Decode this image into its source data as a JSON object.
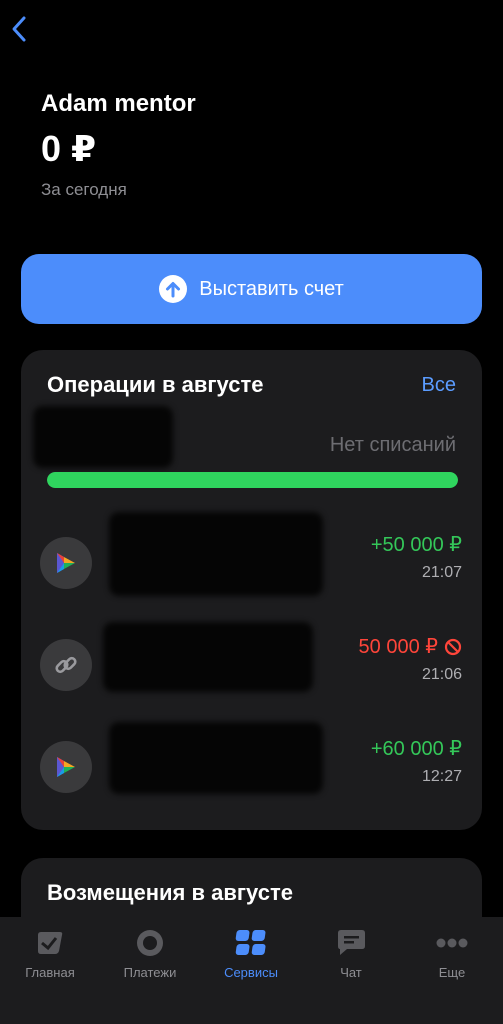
{
  "header": {
    "title": "Adam mentor",
    "amount": "0 ₽",
    "subtitle": "За сегодня"
  },
  "invoice_button": {
    "label": "Выставить счет"
  },
  "operations": {
    "title": "Операции в августе",
    "all_label": "Все",
    "no_charges": "Нет списаний",
    "progress_fraction": 1.0,
    "items": [
      {
        "amount": "+50 000 ₽",
        "time": "21:07",
        "type": "income",
        "icon": "sbp-icon"
      },
      {
        "amount": "50 000 ₽",
        "time": "21:06",
        "type": "declined",
        "icon": "link-icon"
      },
      {
        "amount": "+60 000 ₽",
        "time": "12:27",
        "type": "income",
        "icon": "sbp-icon"
      }
    ]
  },
  "compensations": {
    "title": "Возмещения в августе"
  },
  "tabbar": {
    "tabs": [
      {
        "label": "Главная",
        "icon": "home-icon",
        "active": false
      },
      {
        "label": "Платежи",
        "icon": "payments-icon",
        "active": false
      },
      {
        "label": "Сервисы",
        "icon": "services-icon",
        "active": true
      },
      {
        "label": "Чат",
        "icon": "chat-icon",
        "active": false
      },
      {
        "label": "Еще",
        "icon": "more-icon",
        "active": false
      }
    ]
  },
  "colors": {
    "accent": "#4c8dfb",
    "positive": "#34c759",
    "negative": "#ff453a",
    "progress": "#2fd55e"
  }
}
